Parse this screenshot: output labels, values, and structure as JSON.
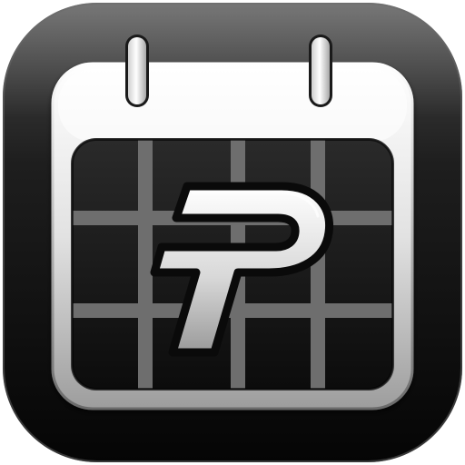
{
  "app_icon": {
    "glyph": "pashcal-p-logo",
    "icon": "calendar-icon",
    "colors": {
      "outer_tile_top": "#4a4a4a",
      "outer_tile_bottom": "#050505",
      "calendar_frame_top": "#ffffff",
      "calendar_frame_bottom": "#9d9d9d",
      "grid_panel": "#141414",
      "grid_lines": "#6e6e6e",
      "logo_fill_top": "#ffffff",
      "logo_fill_bottom": "#9a9a9a",
      "logo_outline": "#0a0a0a"
    }
  }
}
